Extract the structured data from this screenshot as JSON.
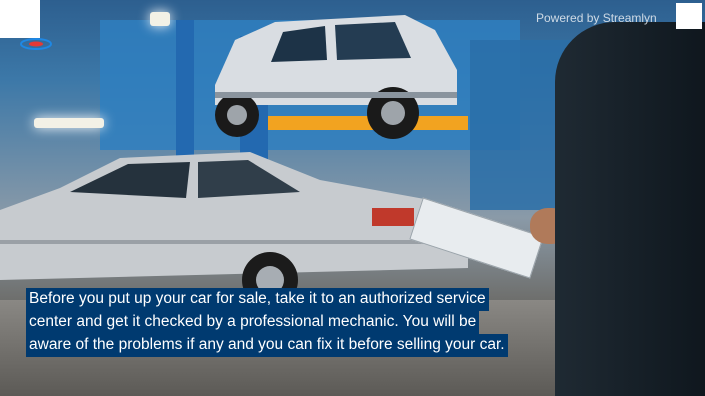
{
  "video": {
    "scene": "auto-service-garage",
    "watermark_text": "Powered by Streamlyn",
    "colors": {
      "caption_bg": "#003a70",
      "caption_text": "#ffffff",
      "lift_arm": "#f2a320",
      "wall": "#2f7fc0"
    }
  },
  "caption": {
    "lines": [
      "Before you put up your car for sale, take it to an authorized service",
      "center and get it checked by a professional mechanic. You will be",
      "aware of the problems if any and you can fix it before selling your car."
    ]
  },
  "icons": {
    "logo": "brand-logo-icon"
  }
}
